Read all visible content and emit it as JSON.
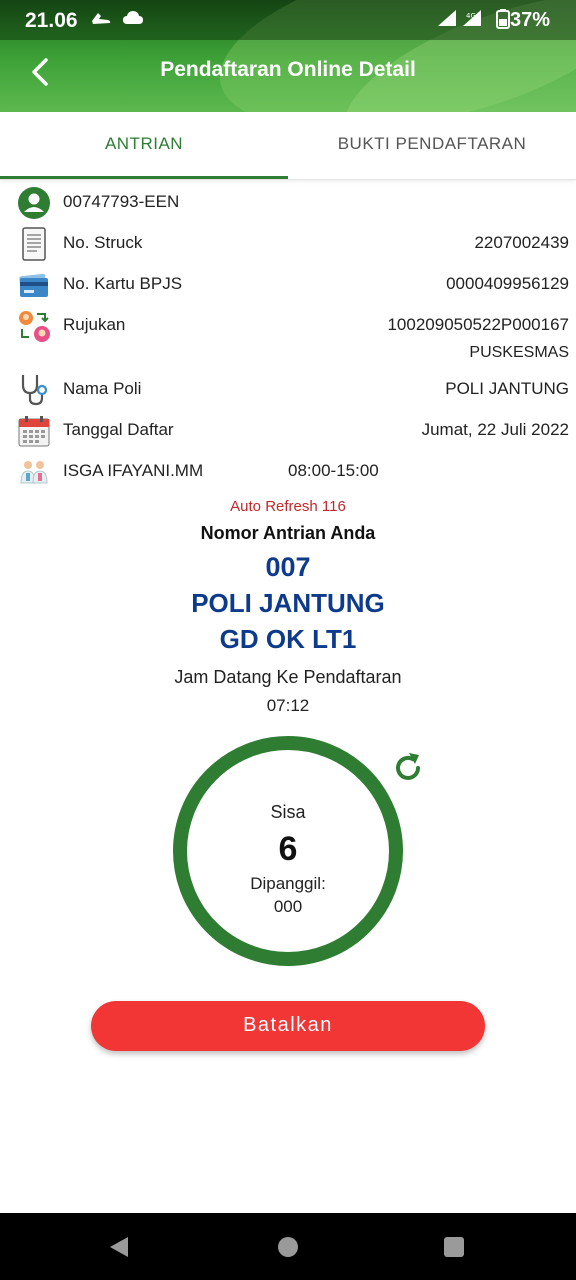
{
  "status_bar": {
    "time": "21.06",
    "network": "4G",
    "battery": "37%"
  },
  "appbar": {
    "title": "Pendaftaran Online Detail"
  },
  "tabs": [
    {
      "label": "ANTRIAN",
      "active": true
    },
    {
      "label": "BUKTI PENDAFTARAN",
      "active": false
    }
  ],
  "details": {
    "patient_id": "00747793-EEN",
    "struck_label": "No. Struck",
    "struck_value": "2207002439",
    "bpjs_label": "No. Kartu BPJS",
    "bpjs_value": "0000409956129",
    "rujukan_label": "Rujukan",
    "rujukan_value": "100209050522P000167",
    "rujukan_source": "PUSKESMAS",
    "poli_label": "Nama Poli",
    "poli_value": "POLI JANTUNG",
    "tanggal_label": "Tanggal Daftar",
    "tanggal_value": "Jumat, 22 Juli 2022",
    "doctor_name": "ISGA IFAYANI.MM",
    "doctor_hours": "08:00-15:00"
  },
  "queue": {
    "auto_refresh": "Auto Refresh 116",
    "title": "Nomor Antrian Anda",
    "number": "007",
    "poli": "POLI JANTUNG",
    "room": "GD OK LT1",
    "arrival_label": "Jam Datang Ke Pendaftaran",
    "arrival_time": "07:12",
    "remaining_label": "Sisa",
    "remaining_value": "6",
    "called_label": "Dipanggil:",
    "called_value": "000"
  },
  "actions": {
    "cancel_label": "Batalkan"
  },
  "colors": {
    "primary_green": "#2e7d32",
    "queue_blue": "#0d3a8a",
    "refresh_red": "#c0282d",
    "cancel_red": "#f23535"
  },
  "icons": {
    "back": "arrow-left-icon",
    "patient": "person-circle-icon",
    "struck": "receipt-icon",
    "bpjs": "card-icon",
    "rujukan": "referral-icon",
    "poli": "stethoscope-icon",
    "tanggal": "calendar-icon",
    "doctor": "doctors-icon",
    "refresh": "refresh-icon"
  }
}
